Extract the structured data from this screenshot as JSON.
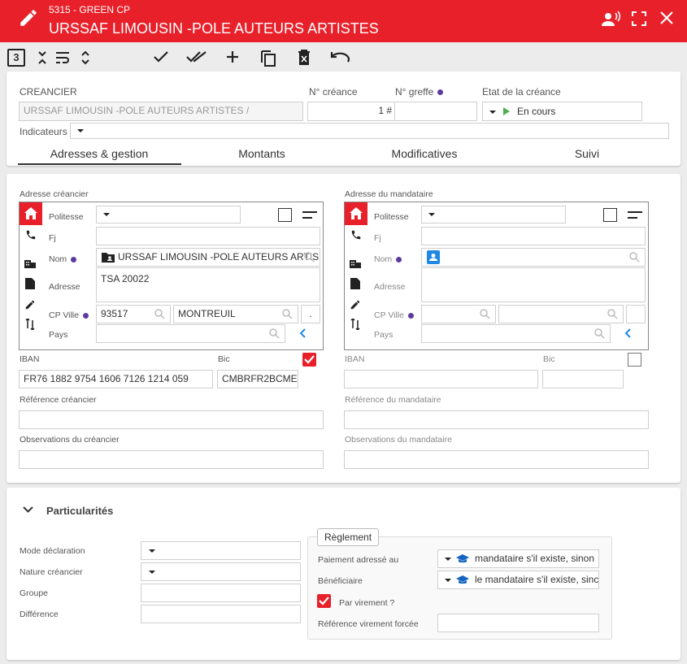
{
  "header": {
    "subtitle": "5315 - GREEN CP",
    "title": "URSSAF LIMOUSIN -POLE AUTEURS ARTISTES"
  },
  "toolbar": {
    "badge": "3"
  },
  "creancier": {
    "label": "CREANCIER",
    "value": "URSSAF LIMOUSIN -POLE AUTEURS ARTISTES /",
    "num_label": "N° créance",
    "num_value": "1 #",
    "greffe_label": "N° greffe",
    "etat_label": "Etat de la créance",
    "etat_value": "En cours",
    "indicateurs_label": "Indicateurs"
  },
  "tabs": [
    "Adresses & gestion",
    "Montants",
    "Modificatives",
    "Suivi"
  ],
  "left": {
    "title": "Adresse créancier",
    "politesse": "Politesse",
    "fj": "Fj",
    "nom": "Nom",
    "nom_value": "URSSAF LIMOUSIN -POLE AUTEURS ARTIS",
    "adresse": "Adresse",
    "adresse_value": "TSA 20022",
    "cpville": "CP Ville",
    "cp_value": "93517",
    "ville_value": "MONTREUIL",
    "extra_value": ".",
    "pays": "Pays",
    "iban_label": "IBAN",
    "iban_value": "FR76 1882 9754 1606 7126 1214 059",
    "bic_label": "Bic",
    "bic_value": "CMBRFR2BCME",
    "ref_label": "Référence créancier",
    "obs_label": "Observations du créancier"
  },
  "right": {
    "title": "Adresse du mandataire",
    "politesse": "Politesse",
    "fj": "Fj",
    "nom": "Nom",
    "adresse": "Adresse",
    "cpville": "CP Ville",
    "pays": "Pays",
    "iban_label": "IBAN",
    "bic_label": "Bic",
    "ref_label": "Référence du mandataire",
    "obs_label": "Observations du mandataire"
  },
  "particularites": {
    "title": "Particularités",
    "mode": "Mode déclaration",
    "nature": "Nature créancier",
    "groupe": "Groupe",
    "difference": "Différence",
    "reglement": "Règlement",
    "paiement_label": "Paiement adressé au",
    "paiement_value": "mandataire s'il existe, sinon",
    "benef_label": "Bénéficiaire",
    "benef_value": "le mandataire s'il existe, sinc",
    "virement": "Par virement ?",
    "ref_virement": "Référence virement forcée"
  },
  "colors": {
    "accent": "#e8202a",
    "tab_underline": "#333",
    "info": "#5b3c9e",
    "link": "#1e88e5"
  }
}
